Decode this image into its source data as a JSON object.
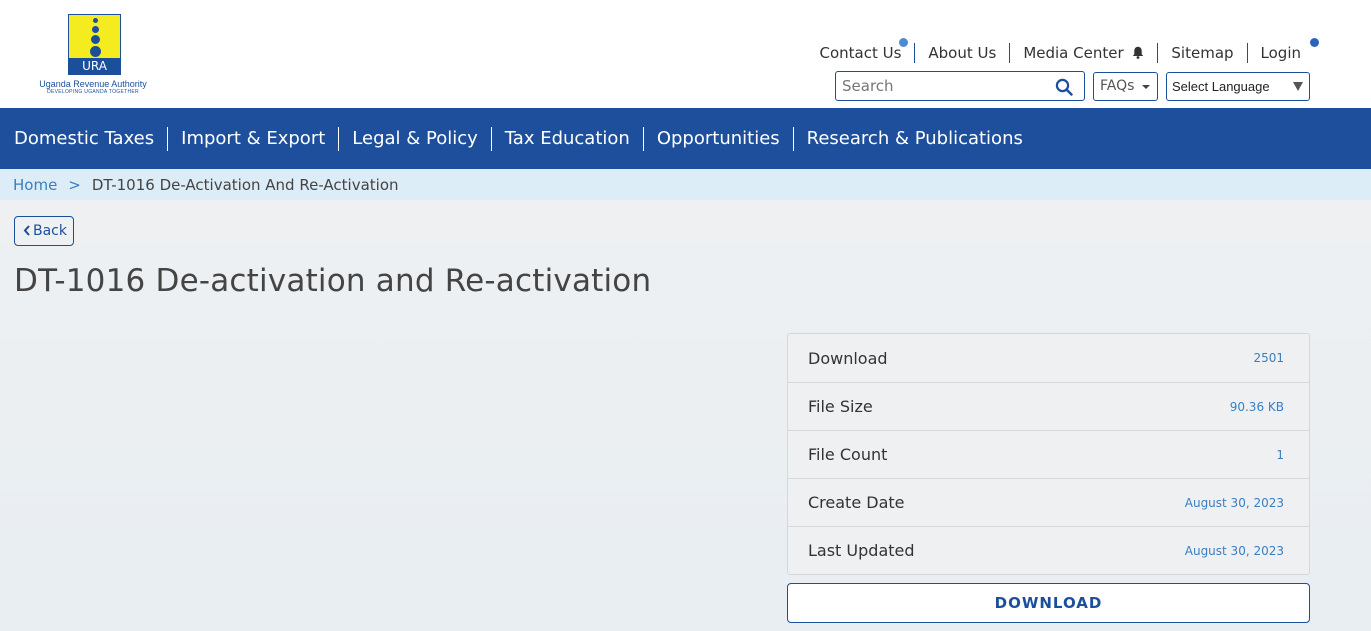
{
  "header": {
    "logo": {
      "abbr": "URA",
      "name": "Uganda Revenue Authority",
      "tagline": "DEVELOPING UGANDA TOGETHER"
    },
    "topnav": [
      {
        "label": "Contact Us",
        "dot": true
      },
      {
        "label": "About Us",
        "dot": false
      },
      {
        "label": "Media Center",
        "icon": "bell-icon",
        "dot": false
      },
      {
        "label": "Sitemap",
        "dot": false
      },
      {
        "label": "Login",
        "dot": true
      }
    ],
    "search": {
      "placeholder": "Search",
      "value": ""
    },
    "faqs_label": "FAQs",
    "language_select": "Select Language"
  },
  "mainnav": [
    "Domestic Taxes",
    "Import & Export",
    "Legal & Policy",
    "Tax Education",
    "Opportunities",
    "Research & Publications"
  ],
  "breadcrumb": {
    "home": "Home",
    "separator": ">",
    "current": "DT-1016 De-Activation And Re-Activation"
  },
  "back_label": "Back",
  "page_title": "DT-1016 De-activation and Re-activation",
  "info": [
    {
      "label": "Download",
      "value": "2501"
    },
    {
      "label": "File Size",
      "value": "90.36 KB"
    },
    {
      "label": "File Count",
      "value": "1"
    },
    {
      "label": "Create Date",
      "value": "August 30, 2023"
    },
    {
      "label": "Last Updated",
      "value": "August 30, 2023"
    }
  ],
  "download_label": "DOWNLOAD",
  "colors": {
    "brand_blue": "#1d4f9c",
    "link_blue": "#3a7fc1",
    "logo_yellow": "#f4ec1e",
    "breadcrumb_bg": "#dcedf7"
  }
}
